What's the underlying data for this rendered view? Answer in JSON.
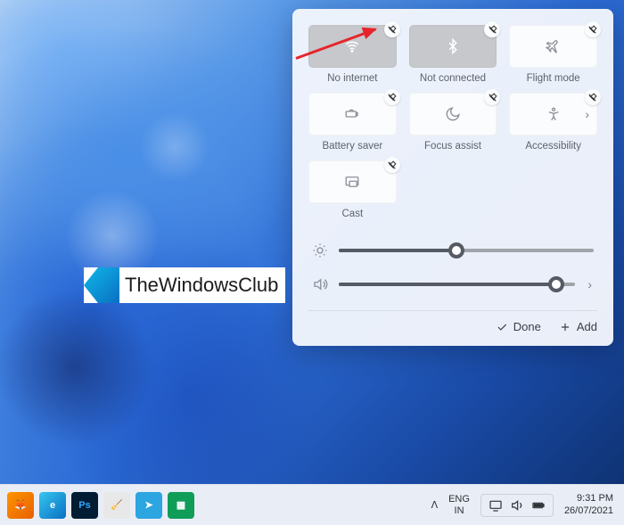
{
  "panel": {
    "tiles": [
      {
        "id": "wifi",
        "label": "No internet",
        "active": true,
        "icon": "wifi-icon"
      },
      {
        "id": "bluetooth",
        "label": "Not connected",
        "active": true,
        "icon": "bluetooth-icon"
      },
      {
        "id": "flight",
        "label": "Flight mode",
        "active": false,
        "icon": "airplane-icon"
      },
      {
        "id": "battery",
        "label": "Battery saver",
        "active": false,
        "icon": "battery-saver-icon"
      },
      {
        "id": "focus",
        "label": "Focus assist",
        "active": false,
        "icon": "moon-icon"
      },
      {
        "id": "access",
        "label": "Accessibility",
        "active": false,
        "icon": "accessibility-icon"
      },
      {
        "id": "cast",
        "label": "Cast",
        "active": false,
        "icon": "cast-icon"
      }
    ],
    "sliders": {
      "brightness": 46,
      "volume": 92
    },
    "footer": {
      "done": "Done",
      "add": "Add"
    }
  },
  "taskbar": {
    "apps": [
      {
        "id": "firefox",
        "bg": "linear-gradient(135deg,#ff9500,#e66000)",
        "glyph": "🦊"
      },
      {
        "id": "edge",
        "bg": "linear-gradient(135deg,#0fb8e8,#0a6fc2)",
        "glyph": "e"
      },
      {
        "id": "photoshop",
        "bg": "#001d34",
        "glyph": "Ps"
      },
      {
        "id": "ccleaner",
        "bg": "#e02828",
        "glyph": "🧹"
      },
      {
        "id": "telegram",
        "bg": "#2ca5e0",
        "glyph": "✈"
      },
      {
        "id": "libre",
        "bg": "#0f9d58",
        "glyph": "≡"
      }
    ],
    "tray_up": "ᐱ",
    "lang1": "ENG",
    "lang2": "IN",
    "time": "9:31 PM",
    "date": "26/07/2021"
  },
  "watermark": {
    "text": "TheWindowsClub"
  }
}
